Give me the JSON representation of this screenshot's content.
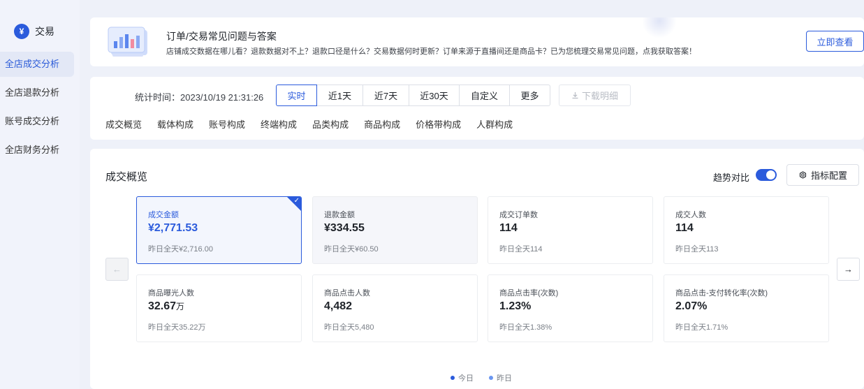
{
  "colors": {
    "accent": "#2b5bdc",
    "legend_yesterday": "#6a96f0"
  },
  "sidebar": {
    "brand": {
      "icon": "yuan-icon",
      "icon_glyph": "¥",
      "label": "交易"
    },
    "items": [
      {
        "label": "全店成交分析",
        "active": true
      },
      {
        "label": "全店退款分析",
        "active": false
      },
      {
        "label": "账号成交分析",
        "active": false
      },
      {
        "label": "全店财务分析",
        "active": false
      }
    ]
  },
  "banner": {
    "title": "订单/交易常见问题与答案",
    "description": "店铺成交数据在哪儿看？退款数据对不上？退款口径是什么？交易数据何时更新？订单来源于直播间还是商品卡？已为您梳理交易常见问题，点我获取答案！",
    "button": "立即查看"
  },
  "filter": {
    "stat_time": "统计时间：2023/10/19 21:31:26",
    "ranges": [
      "实时",
      "近1天",
      "近7天",
      "近30天",
      "自定义",
      "更多"
    ],
    "selected_range": "实时",
    "download": "下载明细",
    "tabs": [
      "成交概览",
      "载体构成",
      "账号构成",
      "终端构成",
      "品类构成",
      "商品构成",
      "价格带构成",
      "人群构成"
    ]
  },
  "overview": {
    "title": "成交概览",
    "trend_label": "趋势对比",
    "trend_on": true,
    "config_button": "指标配置",
    "metrics": [
      {
        "label": "成交金额",
        "value": "¥2,771.53",
        "unit": "",
        "prev": "昨日全天¥2,716.00"
      },
      {
        "label": "退款金额",
        "value": "¥334.55",
        "unit": "",
        "prev": "昨日全天¥60.50"
      },
      {
        "label": "成交订单数",
        "value": "114",
        "unit": "",
        "prev": "昨日全天114"
      },
      {
        "label": "成交人数",
        "value": "114",
        "unit": "",
        "prev": "昨日全天113"
      },
      {
        "label": "商品曝光人数",
        "value": "32.67",
        "unit": "万",
        "prev": "昨日全天35.22万"
      },
      {
        "label": "商品点击人数",
        "value": "4,482",
        "unit": "",
        "prev": "昨日全天5,480"
      },
      {
        "label": "商品点击率(次数)",
        "value": "1.23%",
        "unit": "",
        "prev": "昨日全天1.38%"
      },
      {
        "label": "商品点击-支付转化率(次数)",
        "value": "2.07%",
        "unit": "",
        "prev": "昨日全天1.71%"
      }
    ],
    "legend": [
      "今日",
      "昨日"
    ]
  }
}
